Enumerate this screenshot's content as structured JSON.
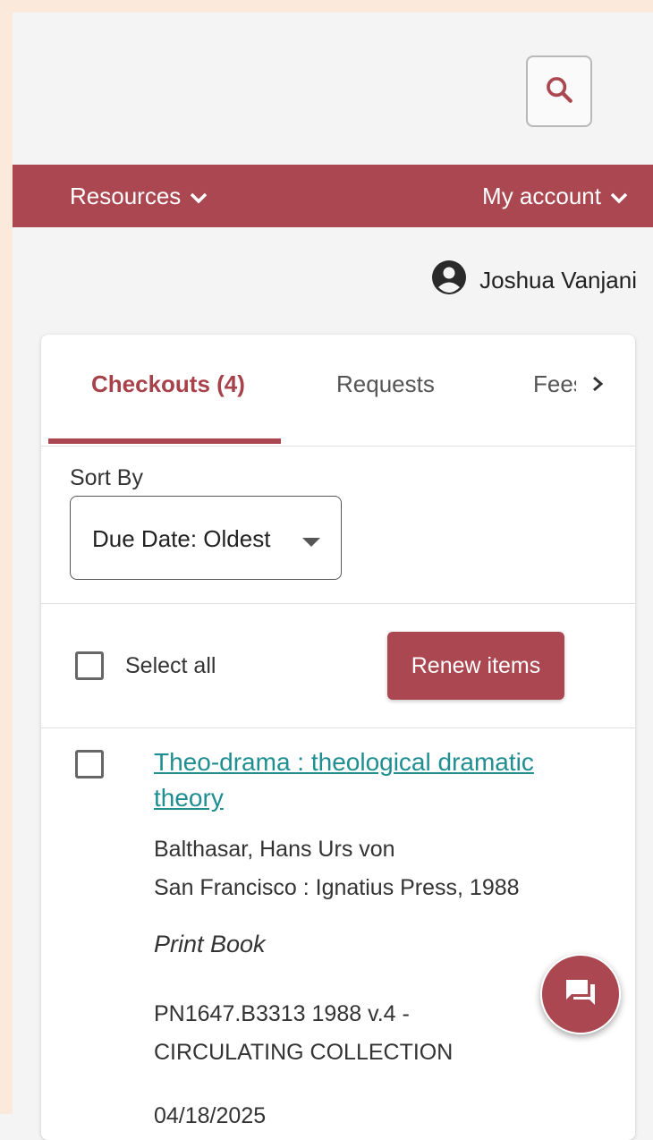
{
  "colors": {
    "accent": "#ab4750",
    "link": "#1f8e91"
  },
  "header": {
    "search_icon": "search-icon"
  },
  "nav": {
    "resources_label": "Resources",
    "account_label": "My account"
  },
  "user": {
    "name": "Joshua Vanjani",
    "icon": "account-circle-icon"
  },
  "tabs": [
    {
      "label": "Checkouts (4)",
      "active": true
    },
    {
      "label": "Requests",
      "active": false
    },
    {
      "label": "Fees",
      "active": false
    }
  ],
  "sort": {
    "label": "Sort By",
    "selected": "Due Date: Oldest"
  },
  "actions": {
    "select_all_label": "Select all",
    "renew_label": "Renew items"
  },
  "items": [
    {
      "title_line1": "Theo-drama : theological dramatic",
      "title_line2": "theory",
      "author": "Balthasar, Hans Urs von",
      "publisher": "San Francisco : Ignatius Press, 1988",
      "format": "Print Book",
      "call_number_line1": "PN1647.B3313 1988 v.4 -",
      "call_number_line2": "CIRCULATING COLLECTION",
      "due_date": "04/18/2025"
    }
  ]
}
